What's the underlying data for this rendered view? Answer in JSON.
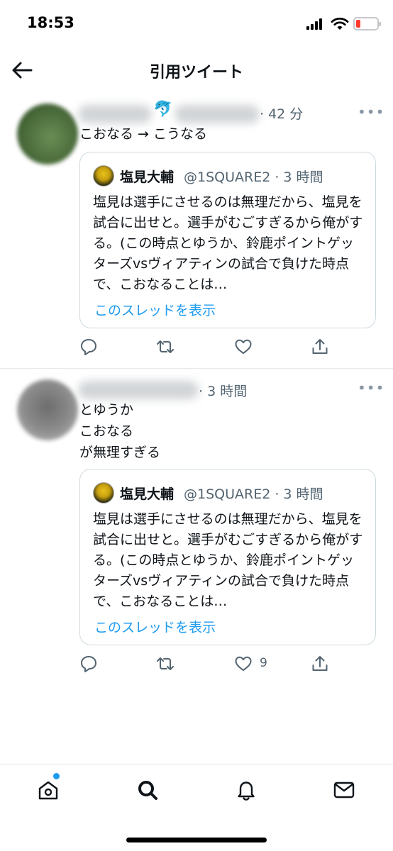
{
  "status_bar": {
    "time": "18:53"
  },
  "header": {
    "title": "引用ツイート"
  },
  "tweets": [
    {
      "time": "· 42 分",
      "text": "こおなる → こうなる",
      "quote": {
        "name": "塩見大輔",
        "handle": "@1SQUARE2 · 3 時間",
        "body": "塩見は選手にさせるのは無理だから、塩見を試合に出せと。選手がむごすぎるから俺がする。(この時点とゆうか、鈴鹿ポイントゲッターズvsヴィアティンの試合で負けた時点で、こおなることは…",
        "link": "このスレッドを表示"
      },
      "likes": ""
    },
    {
      "time": "· 3 時間",
      "text": "とゆうか\nこおなる\nが無理すぎる",
      "quote": {
        "name": "塩見大輔",
        "handle": "@1SQUARE2 · 3 時間",
        "body": "塩見は選手にさせるのは無理だから、塩見を試合に出せと。選手がむごすぎるから俺がする。(この時点とゆうか、鈴鹿ポイントゲッターズvsヴィアティンの試合で負けた時点で、こおなることは…",
        "link": "このスレッドを表示"
      },
      "likes": "9"
    }
  ],
  "icons": {
    "emoji_tweet1": "🐬",
    "more": "•••"
  },
  "colors": {
    "accent": "#1d9bf0",
    "secondary_text": "#536471",
    "border": "#cfd9de",
    "battery_low": "#ff3b30"
  }
}
